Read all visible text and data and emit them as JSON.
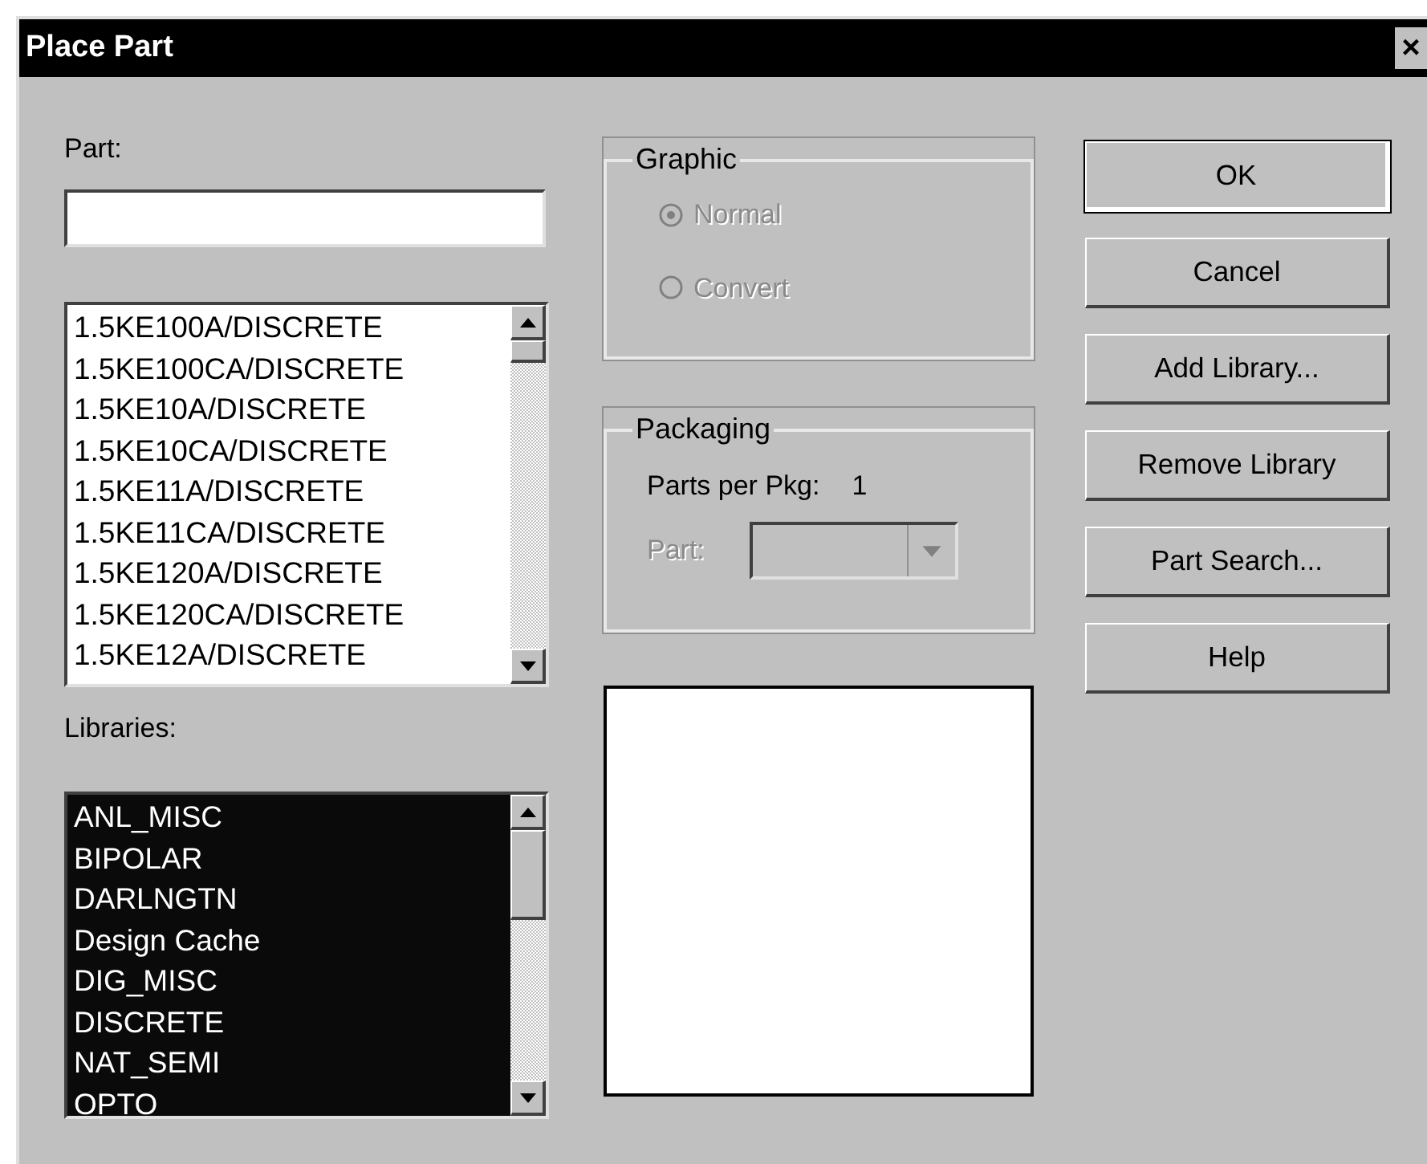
{
  "window": {
    "title": "Place Part",
    "close": "×"
  },
  "part": {
    "label": "Part:"
  },
  "part_list": {
    "items": [
      {
        "text": "1.5KE100A/DISCRETE",
        "selected": false
      },
      {
        "text": "1.5KE100CA/DISCRETE",
        "selected": false
      },
      {
        "text": "1.5KE10A/DISCRETE",
        "selected": false
      },
      {
        "text": "1.5KE10CA/DISCRETE",
        "selected": false
      },
      {
        "text": "1.5KE11A/DISCRETE",
        "selected": false
      },
      {
        "text": "1.5KE11CA/DISCRETE",
        "selected": false
      },
      {
        "text": "1.5KE120A/DISCRETE",
        "selected": false
      },
      {
        "text": "1.5KE120CA/DISCRETE",
        "selected": false
      },
      {
        "text": "1.5KE12A/DISCRETE",
        "selected": false
      }
    ]
  },
  "libraries": {
    "label": "Libraries:",
    "items": [
      {
        "text": "ANL_MISC",
        "selected": true
      },
      {
        "text": "BIPOLAR",
        "selected": true
      },
      {
        "text": "DARLNGTN",
        "selected": true
      },
      {
        "text": "Design Cache",
        "selected": true
      },
      {
        "text": "DIG_MISC",
        "selected": true
      },
      {
        "text": "DISCRETE",
        "selected": true
      },
      {
        "text": "NAT_SEMI",
        "selected": true
      },
      {
        "text": "OPTO",
        "selected": true
      }
    ]
  },
  "graphic": {
    "title": "Graphic",
    "options": [
      {
        "label": "Normal",
        "checked": true,
        "disabled": true
      },
      {
        "label": "Convert",
        "checked": false,
        "disabled": true
      }
    ]
  },
  "packaging": {
    "title": "Packaging",
    "parts_per_pkg_label": "Parts per Pkg:",
    "parts_per_pkg_value": "1",
    "part_label": "Part:",
    "part_disabled": true
  },
  "buttons": [
    {
      "label": "OK",
      "default": true
    },
    {
      "label": "Cancel",
      "default": false
    },
    {
      "label": "Add Library...",
      "default": false
    },
    {
      "label": "Remove Library",
      "default": false
    },
    {
      "label": "Part Search...",
      "default": false
    },
    {
      "label": "Help",
      "default": false
    }
  ]
}
